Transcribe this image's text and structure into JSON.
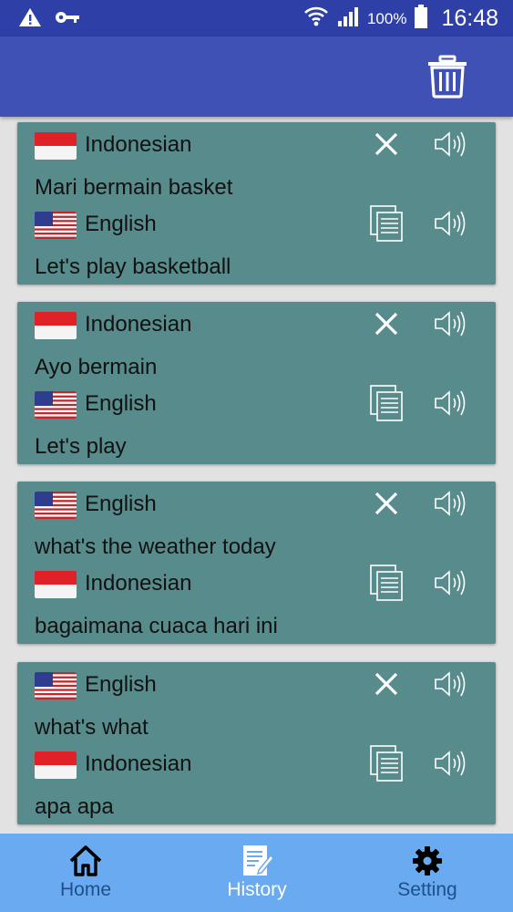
{
  "status_bar": {
    "battery_percent": "100%",
    "time": "16:48"
  },
  "app_bar": {
    "action_icon": "trash-icon"
  },
  "history": [
    {
      "source": {
        "language": "Indonesian",
        "flag": "indonesia",
        "text": "Mari bermain basket"
      },
      "target": {
        "language": "English",
        "flag": "usa",
        "text": "Let's play basketball"
      }
    },
    {
      "source": {
        "language": "Indonesian",
        "flag": "indonesia",
        "text": "Ayo bermain"
      },
      "target": {
        "language": "English",
        "flag": "usa",
        "text": "Let's play"
      }
    },
    {
      "source": {
        "language": "English",
        "flag": "usa",
        "text": "what's the weather today"
      },
      "target": {
        "language": "Indonesian",
        "flag": "indonesia",
        "text": "bagaimana cuaca hari ini"
      }
    },
    {
      "source": {
        "language": "English",
        "flag": "usa",
        "text": "what's what"
      },
      "target": {
        "language": "Indonesian",
        "flag": "indonesia",
        "text": "apa apa"
      }
    }
  ],
  "bottom_nav": {
    "active": "history",
    "items": [
      {
        "key": "home",
        "label": "Home",
        "icon": "home-icon"
      },
      {
        "key": "history",
        "label": "History",
        "icon": "history-icon"
      },
      {
        "key": "setting",
        "label": "Setting",
        "icon": "gear-icon"
      }
    ]
  },
  "colors": {
    "status_bar": "#2f3fa8",
    "app_bar": "#3f51b5",
    "card": "#588c8c",
    "bottom_nav": "#6aaaf0",
    "nav_active": "#ffffff",
    "nav_inactive": "#1f4f8a"
  }
}
